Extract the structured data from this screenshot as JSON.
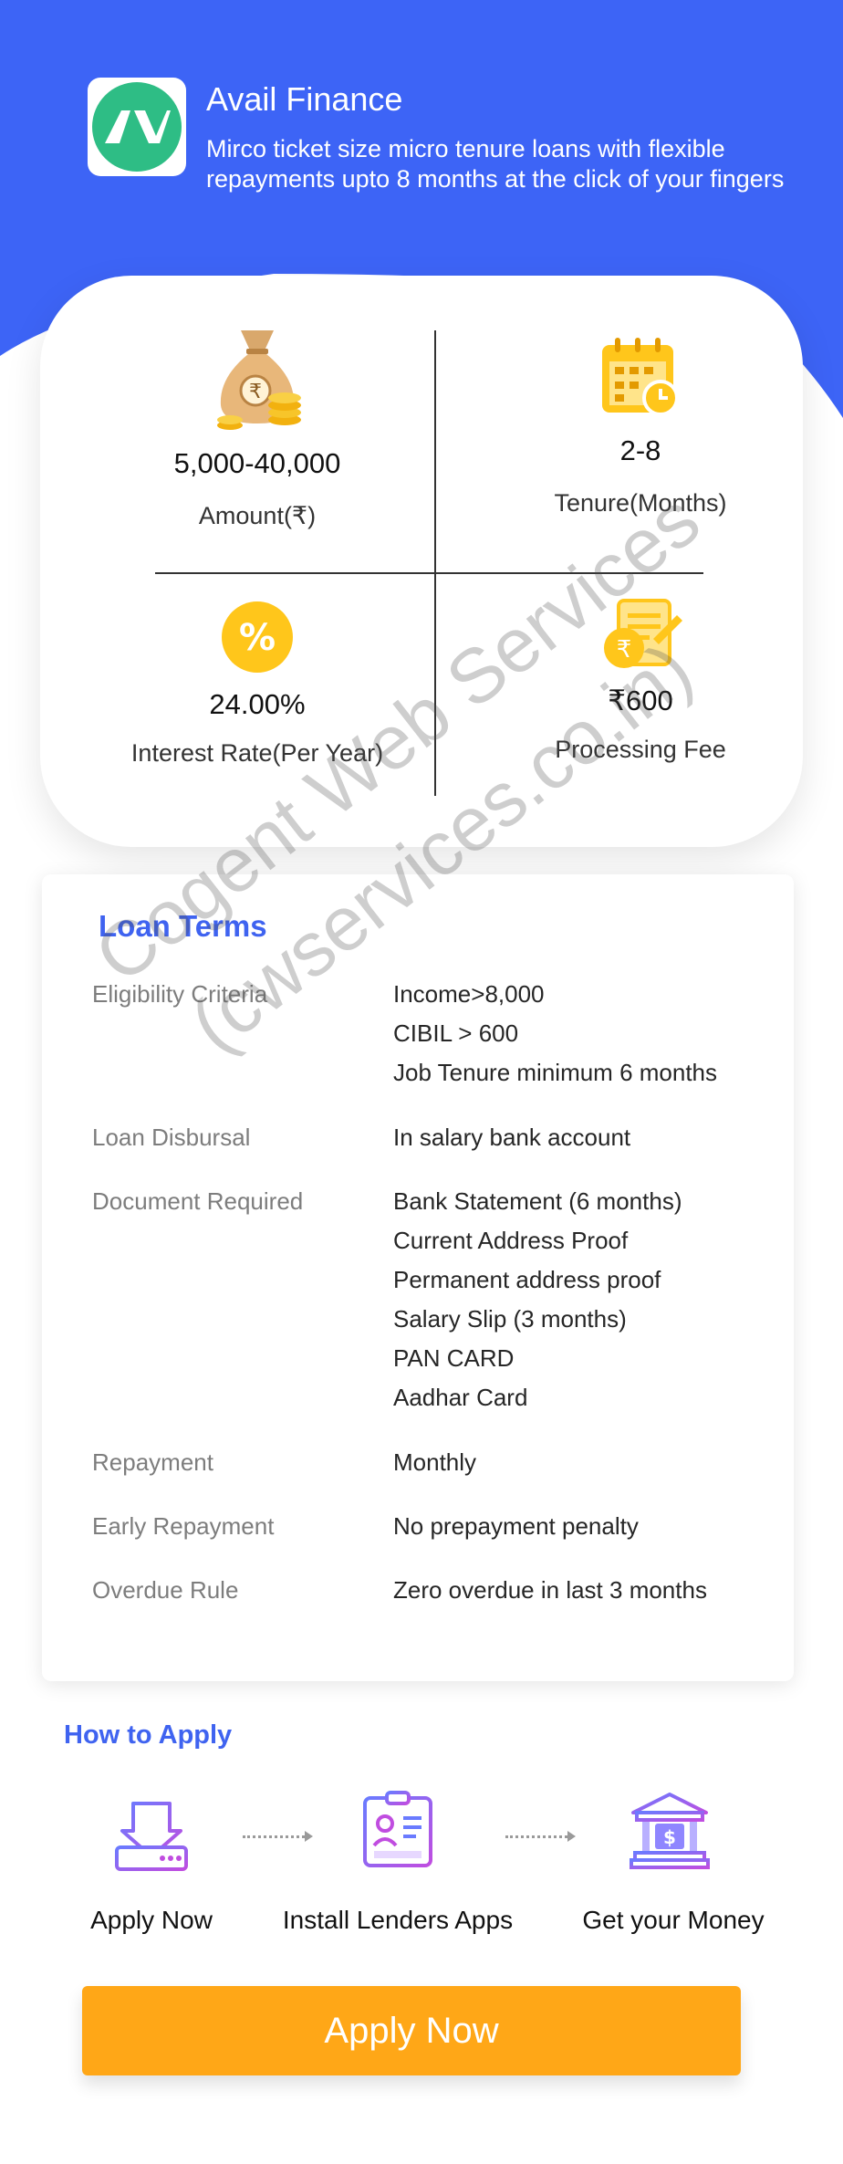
{
  "app": {
    "name": "Avail Finance",
    "logo_text": "AV",
    "description": "Mirco ticket size micro tenure loans with flexible repayments upto 8 months at the click of your fingers"
  },
  "stats": {
    "amount": {
      "value": "5,000-40,000",
      "label": "Amount(₹)"
    },
    "tenure": {
      "value": "2-8",
      "label": "Tenure(Months)"
    },
    "interest": {
      "value": "24.00%",
      "label": "Interest Rate(Per Year)"
    },
    "fee": {
      "value": "₹600",
      "label": "Processing Fee"
    }
  },
  "loan_terms": {
    "title": "Loan Terms",
    "rows": [
      {
        "label": "Eligibility Criteria",
        "values": [
          "Income>8,000",
          "CIBIL > 600",
          "Job Tenure minimum 6 months"
        ]
      },
      {
        "label": "Loan Disbursal",
        "values": [
          "In salary bank account"
        ]
      },
      {
        "label": "Document Required",
        "values": [
          "Bank Statement (6 months)",
          "Current Address Proof",
          "Permanent address proof",
          "Salary Slip (3 months)",
          "PAN CARD",
          "Aadhar Card"
        ]
      },
      {
        "label": "Repayment",
        "values": [
          "Monthly"
        ]
      },
      {
        "label": "Early Repayment",
        "values": [
          "No prepayment penalty"
        ]
      },
      {
        "label": "Overdue Rule",
        "values": [
          "Zero overdue in last 3 months"
        ]
      }
    ]
  },
  "how_to_apply": {
    "title": "How to Apply",
    "steps": [
      {
        "label": "Apply Now",
        "icon": "download-tray-icon"
      },
      {
        "label": "Install Lenders Apps",
        "icon": "id-document-icon"
      },
      {
        "label": "Get your Money",
        "icon": "bank-icon"
      }
    ]
  },
  "cta": {
    "label": "Apply Now"
  },
  "watermark": {
    "line1": "Cogent Web Services",
    "line2": "(cwservices.co.in)"
  },
  "colors": {
    "primary": "#3d64f6",
    "accent": "#ffa717",
    "logo_green": "#2ebd85",
    "link": "#3f63f0"
  }
}
